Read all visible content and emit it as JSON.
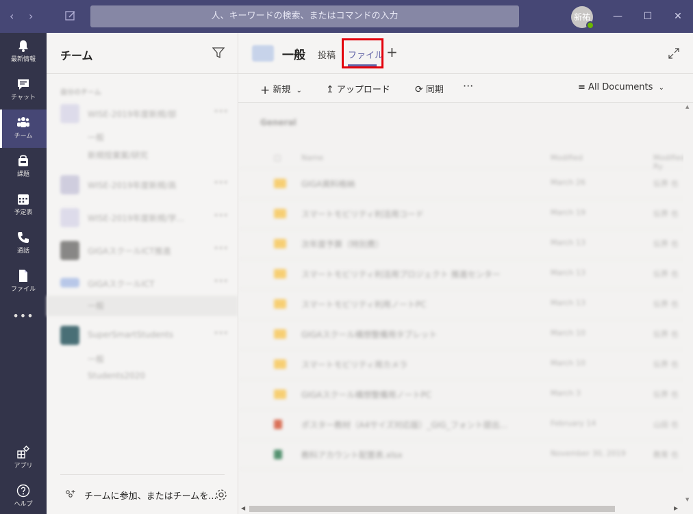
{
  "titlebar": {
    "search_placeholder": "人、キーワードの検索、またはコマンドの入力",
    "avatar_initials": "新祐"
  },
  "appbar": {
    "items": [
      {
        "label": "最新情報",
        "icon": "bell-icon"
      },
      {
        "label": "チャット",
        "icon": "chat-icon"
      },
      {
        "label": "チーム",
        "icon": "teams-icon",
        "active": true
      },
      {
        "label": "課題",
        "icon": "assignments-icon"
      },
      {
        "label": "予定表",
        "icon": "calendar-icon"
      },
      {
        "label": "通話",
        "icon": "phone-icon"
      },
      {
        "label": "ファイル",
        "icon": "file-icon"
      },
      {
        "label": "•••",
        "icon": "more-icon"
      }
    ],
    "bottom": [
      {
        "label": "アプリ",
        "icon": "apps-icon"
      },
      {
        "label": "ヘルプ",
        "icon": "help-icon"
      }
    ]
  },
  "teams_panel": {
    "title": "チーム",
    "section_label": "自分のチーム",
    "teams": [
      {
        "name": "WISE-2019年度新規/部"
      },
      {
        "name": "WISE-2019年度新規/高"
      },
      {
        "name": "WISE-2019年度新規/学..."
      },
      {
        "name": "GIGAスクールICT推進"
      },
      {
        "name": "GIGAスクールICT"
      },
      {
        "name": "SuperSmartStudents"
      }
    ],
    "channels": [
      "一般",
      "新規授業案/研究",
      "一般",
      "一般",
      "Students2020"
    ],
    "join_text": "チームに参加、またはチームを..."
  },
  "channel_header": {
    "channel_name": "一般",
    "tab_posts": "投稿",
    "tab_files": "ファイル"
  },
  "toolbar": {
    "new": "新規",
    "upload": "アップロード",
    "sync": "同期",
    "more": "···",
    "view": "All Documents"
  },
  "documents": {
    "group": "General",
    "col_name": "Name",
    "col_modified": "Modified",
    "col_modified_by": "Modified By",
    "rows": [
      {
        "name": "GIGA資料格納",
        "date": "March 26",
        "by": "伝界 也",
        "type": "folder"
      },
      {
        "name": "スマートモビリティ利活用コード",
        "date": "March 19",
        "by": "伝界 也",
        "type": "folder"
      },
      {
        "name": "次年度予算（特別費）",
        "date": "March 13",
        "by": "伝界 也",
        "type": "folder"
      },
      {
        "name": "スマートモビリティ利活用プロジェクト 推進センター",
        "date": "March 13",
        "by": "伝界 也",
        "type": "folder"
      },
      {
        "name": "スマートモビリティ利用ノートPC",
        "date": "March 13",
        "by": "伝界 也",
        "type": "folder"
      },
      {
        "name": "GIGAスクール構想整備用タブレット",
        "date": "March 10",
        "by": "伝界 也",
        "type": "folder"
      },
      {
        "name": "スマートモビリティ用カメラ",
        "date": "March 10",
        "by": "伝界 也",
        "type": "folder"
      },
      {
        "name": "GIGAスクール構想整備用ノートPC",
        "date": "March 3",
        "by": "伝界 也",
        "type": "folder"
      },
      {
        "name": "ポスター教材（A4サイズ対応版）_GIG_フォント提出...",
        "date": "February 14",
        "by": "山田 也",
        "type": "ppt"
      },
      {
        "name": "教科アカウント配置表.xlsx",
        "date": "November 30, 2019",
        "by": "教育 也",
        "type": "xlsx"
      }
    ]
  }
}
